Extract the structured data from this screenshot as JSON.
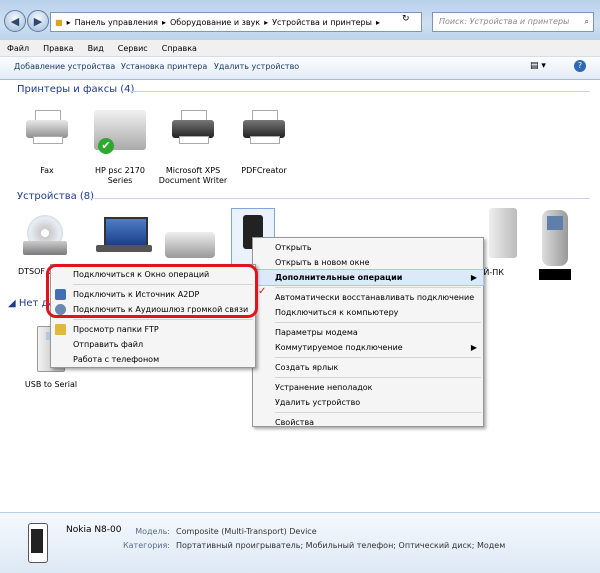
{
  "address": {
    "crumbs": [
      "Панель управления",
      "Оборудование и звук",
      "Устройства и принтеры"
    ]
  },
  "search": {
    "placeholder": "Поиск: Устройства и принтеры"
  },
  "menu": [
    "Файл",
    "Правка",
    "Вид",
    "Сервис",
    "Справка"
  ],
  "commands": [
    "Добавление устройства",
    "Установка принтера",
    "Удалить устройство"
  ],
  "groups": {
    "printers": "Принтеры и факсы (4)",
    "devices": "Устройства (8)",
    "unspecified": "Нет да"
  },
  "printers": [
    {
      "label": "Fax"
    },
    {
      "label": "HP psc 2170 Series"
    },
    {
      "label": "Microsoft XPS Document Writer"
    },
    {
      "label": "PDFCreator"
    }
  ],
  "devices": [
    {
      "label": "DTSOF CdRom"
    },
    {
      "label": "ИЙ-ПК"
    }
  ],
  "unspecified_devices": [
    {
      "label": "USB to Serial"
    }
  ],
  "context_menu": {
    "items": [
      "Открыть",
      "Открыть в новом окне",
      "Дополнительные операции",
      "Автоматически восстанавливать подключение",
      "Подключиться к компьютеру",
      "Параметры модема",
      "Коммутируемое подключение",
      "Создать ярлык",
      "Устранение неполадок",
      "Удалить устройство",
      "Свойства"
    ]
  },
  "submenu": {
    "items": [
      "Подключиться к Окно операций",
      "Подключить к Источник A2DP",
      "Подключить к Аудиошлюз громкой связи",
      "Просмотр папки FTP",
      "Отправить файл",
      "Работа с телефоном"
    ]
  },
  "details": {
    "name": "Nokia N8-00",
    "model_label": "Модель:",
    "model_value": "Composite (Multi-Transport) Device",
    "category_label": "Категория:",
    "category_value": "Портативный проигрыватель; Мобильный телефон; Оптический диск; Модем"
  },
  "colors": {
    "highlight_ring": "#e0141e",
    "group_text": "#1e3b8a",
    "check": "#2fa82f"
  }
}
